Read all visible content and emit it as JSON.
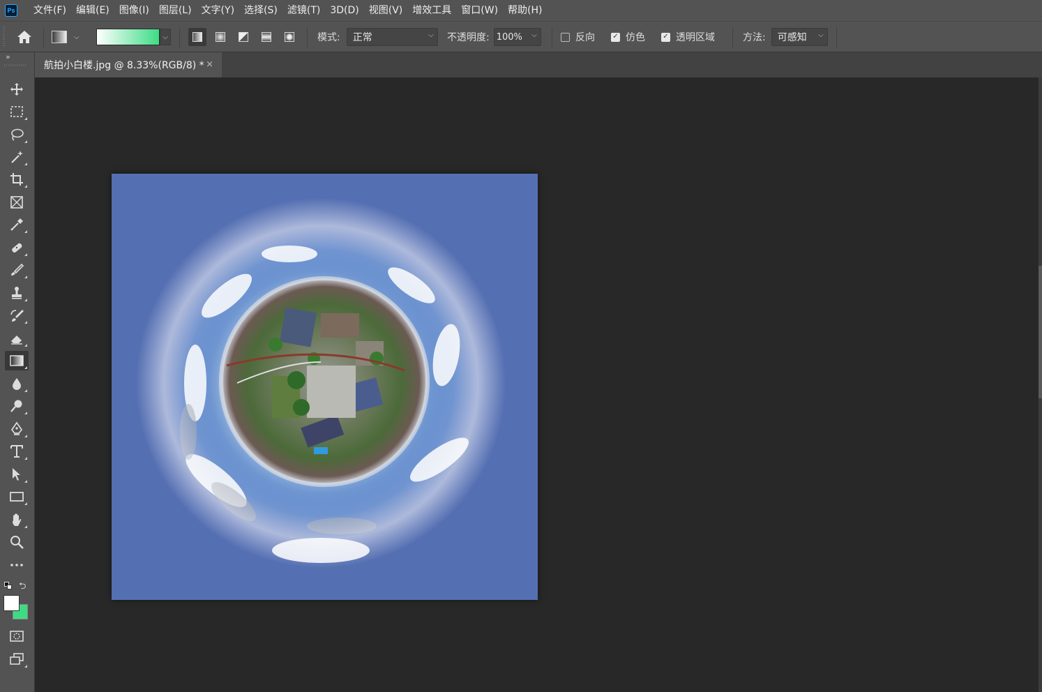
{
  "app": {
    "logo_text": "Ps",
    "menu": [
      "文件(F)",
      "编辑(E)",
      "图像(I)",
      "图层(L)",
      "文字(Y)",
      "选择(S)",
      "滤镜(T)",
      "3D(D)",
      "视图(V)",
      "增效工具",
      "窗口(W)",
      "帮助(H)"
    ]
  },
  "options_bar": {
    "home_icon": "home-icon",
    "gradient_preview_colors": [
      "#ffffff",
      "#3ddc84"
    ],
    "gradient_types": [
      "linear",
      "radial",
      "angle",
      "reflected",
      "diamond"
    ],
    "active_gradient_type": "linear",
    "mode_label": "模式:",
    "mode_value": "正常",
    "opacity_label": "不透明度:",
    "opacity_value": "100%",
    "reverse_label": "反向",
    "reverse_checked": false,
    "dither_label": "仿色",
    "dither_checked": true,
    "transparency_label": "透明区域",
    "transparency_checked": true,
    "method_label": "方法:",
    "method_value": "可感知"
  },
  "document": {
    "tab_title": "航拍小白楼.jpg @ 8.33%(RGB/8) *",
    "close_glyph": "×"
  },
  "toolbar": {
    "collapse_glyph": "»",
    "tools": [
      "move-icon",
      "marquee-icon",
      "lasso-icon",
      "magic-wand-icon",
      "crop-icon",
      "frame-icon",
      "eyedropper-icon",
      "healing-brush-icon",
      "brush-icon",
      "clone-stamp-icon",
      "history-brush-icon",
      "eraser-icon",
      "gradient-icon",
      "blur-icon",
      "dodge-icon",
      "pen-icon",
      "type-icon",
      "path-selection-icon",
      "rectangle-icon",
      "hand-icon",
      "zoom-icon",
      "more-tools-icon"
    ],
    "active_tool": "gradient-icon",
    "foreground_color": "#ffffff",
    "background_color": "#3ddc84"
  },
  "colors": {
    "ui_panel": "#535353",
    "workspace": "#282828",
    "canvas_background": "#5570b2"
  }
}
